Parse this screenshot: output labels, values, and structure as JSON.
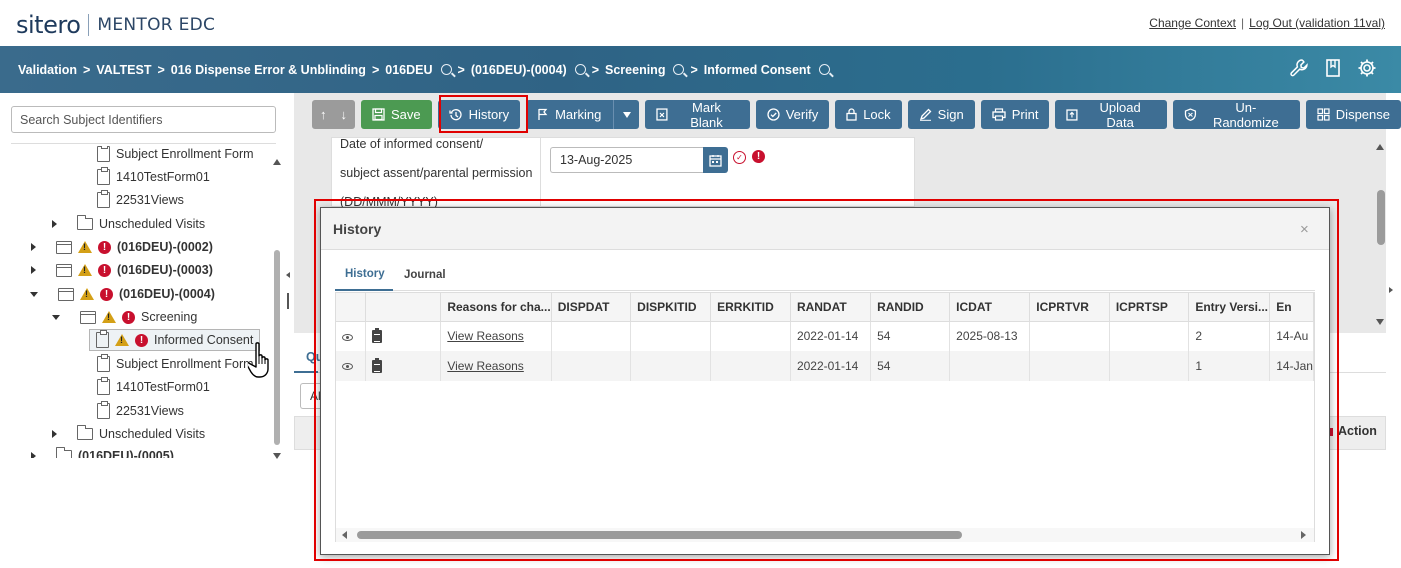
{
  "header": {
    "logo_brand": "sitero",
    "logo_product": "MENTOR EDC",
    "change_context": "Change Context",
    "separator": "|",
    "logout": "Log Out (validation 11val)"
  },
  "breadcrumb": {
    "items": [
      "Validation",
      "VALTEST",
      "016 Dispense Error & Unblinding",
      "016DEU",
      "(016DEU)-(0004)",
      "Screening",
      "Informed Consent"
    ],
    "arrow": ">"
  },
  "header_icons": [
    "wrench-icon",
    "bookmark-icon",
    "gear-icon"
  ],
  "sidebar": {
    "search_placeholder": "Search Subject Identifiers",
    "tree": [
      {
        "label": "Subject Enrollment Form",
        "type": "form"
      },
      {
        "label": "1410TestForm01",
        "type": "form"
      },
      {
        "label": "22531Views",
        "type": "form"
      },
      {
        "label": "Unscheduled Visits",
        "type": "folder"
      },
      {
        "label": "(016DEU)-(0002)",
        "type": "subject"
      },
      {
        "label": "(016DEU)-(0003)",
        "type": "subject"
      },
      {
        "label": "(016DEU)-(0004)",
        "type": "subject"
      },
      {
        "label": "Screening",
        "type": "visit"
      },
      {
        "label": "Informed Consent",
        "type": "form",
        "selected": true
      },
      {
        "label": "Subject Enrollment Form",
        "type": "form"
      },
      {
        "label": "1410TestForm01",
        "type": "form"
      },
      {
        "label": "22531Views",
        "type": "form"
      },
      {
        "label": "Unscheduled Visits",
        "type": "folder"
      },
      {
        "label": "(016DEU)-(0005)",
        "type": "subject"
      }
    ]
  },
  "toolbar": {
    "up": "↑",
    "down": "↓",
    "save": "Save",
    "history": "History",
    "marking": "Marking",
    "mark_blank": "Mark Blank",
    "verify": "Verify",
    "lock": "Lock",
    "sign": "Sign",
    "print": "Print",
    "upload_data": "Upload Data",
    "un_randomize": "Un-Randomize",
    "dispense": "Dispense"
  },
  "form": {
    "label_line1": "Date of informed consent/",
    "label_line2": "subject assent/parental permission",
    "label_line3": "(DD/MMM/YYYY)",
    "date_value": "13-Aug-2025"
  },
  "lower": {
    "tab_fragment": "Qu",
    "select_fragment": "Al",
    "action_header": "Action"
  },
  "modal": {
    "title": "History",
    "close": "×",
    "tabs": [
      "History",
      "Journal"
    ],
    "columns": [
      "",
      "",
      "Reasons for cha...",
      "DISPDAT",
      "DISPKITID",
      "ERRKITID",
      "RANDAT",
      "RANDID",
      "ICDAT",
      "ICPRTVR",
      "ICPRTSP",
      "Entry Versi...",
      "En"
    ],
    "rows": [
      {
        "reasons": "View Reasons",
        "DISPDAT": "",
        "DISPKITID": "",
        "ERRKITID": "",
        "RANDAT": "2022-01-14",
        "RANDID": "54",
        "ICDAT": "2025-08-13",
        "ICPRTVR": "",
        "ICPRTSP": "",
        "entry_version": "2",
        "en": "14-Au"
      },
      {
        "reasons": "View Reasons",
        "DISPDAT": "",
        "DISPKITID": "",
        "ERRKITID": "",
        "RANDAT": "2022-01-14",
        "RANDID": "54",
        "ICDAT": "",
        "ICPRTVR": "",
        "ICPRTSP": "",
        "entry_version": "1",
        "en": "14-Jan"
      }
    ]
  },
  "colors": {
    "primary": "#3e6e93",
    "save": "#4c9a52",
    "error": "#c8102e",
    "warning": "#d4a017",
    "highlight": "#e00000"
  }
}
